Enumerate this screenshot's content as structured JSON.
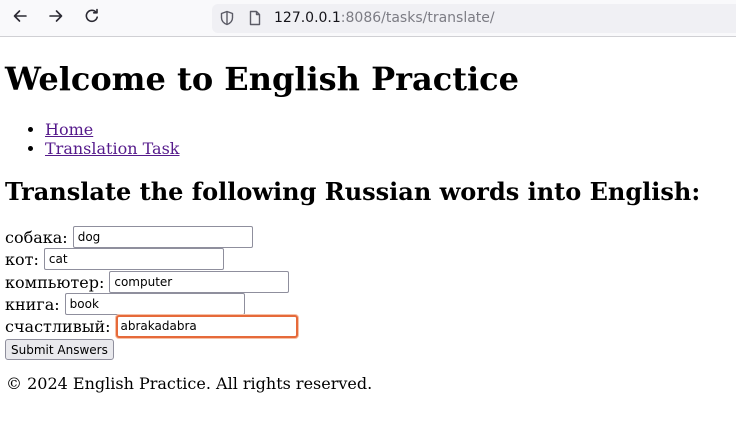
{
  "browser": {
    "back_icon": "arrow-left-icon",
    "forward_icon": "arrow-right-icon",
    "reload_icon": "reload-icon",
    "tracking_icon": "shield-icon",
    "page_info_icon": "page-icon",
    "url_host": "127.0.0.1",
    "url_rest": ":8086/tasks/translate/"
  },
  "page": {
    "title": "Welcome to English Practice",
    "nav": [
      {
        "label": "Home"
      },
      {
        "label": "Translation Task"
      }
    ],
    "task_heading": "Translate the following Russian words into English:",
    "fields": [
      {
        "label": "собака:",
        "value": "dog"
      },
      {
        "label": "кот:",
        "value": "cat"
      },
      {
        "label": "компьютер:",
        "value": "computer"
      },
      {
        "label": "книга:",
        "value": "book"
      },
      {
        "label": "счастливый:",
        "value": "abrakadabra",
        "focused": true
      }
    ],
    "submit_label": "Submit Answers",
    "footer": "© 2024 English Practice. All rights reserved."
  },
  "colors": {
    "link_visited": "#551a8b",
    "focus_ring": "#e66a3a",
    "toolbar_bg": "#f9f9fb",
    "urlbar_bg": "#f0f0f4"
  }
}
